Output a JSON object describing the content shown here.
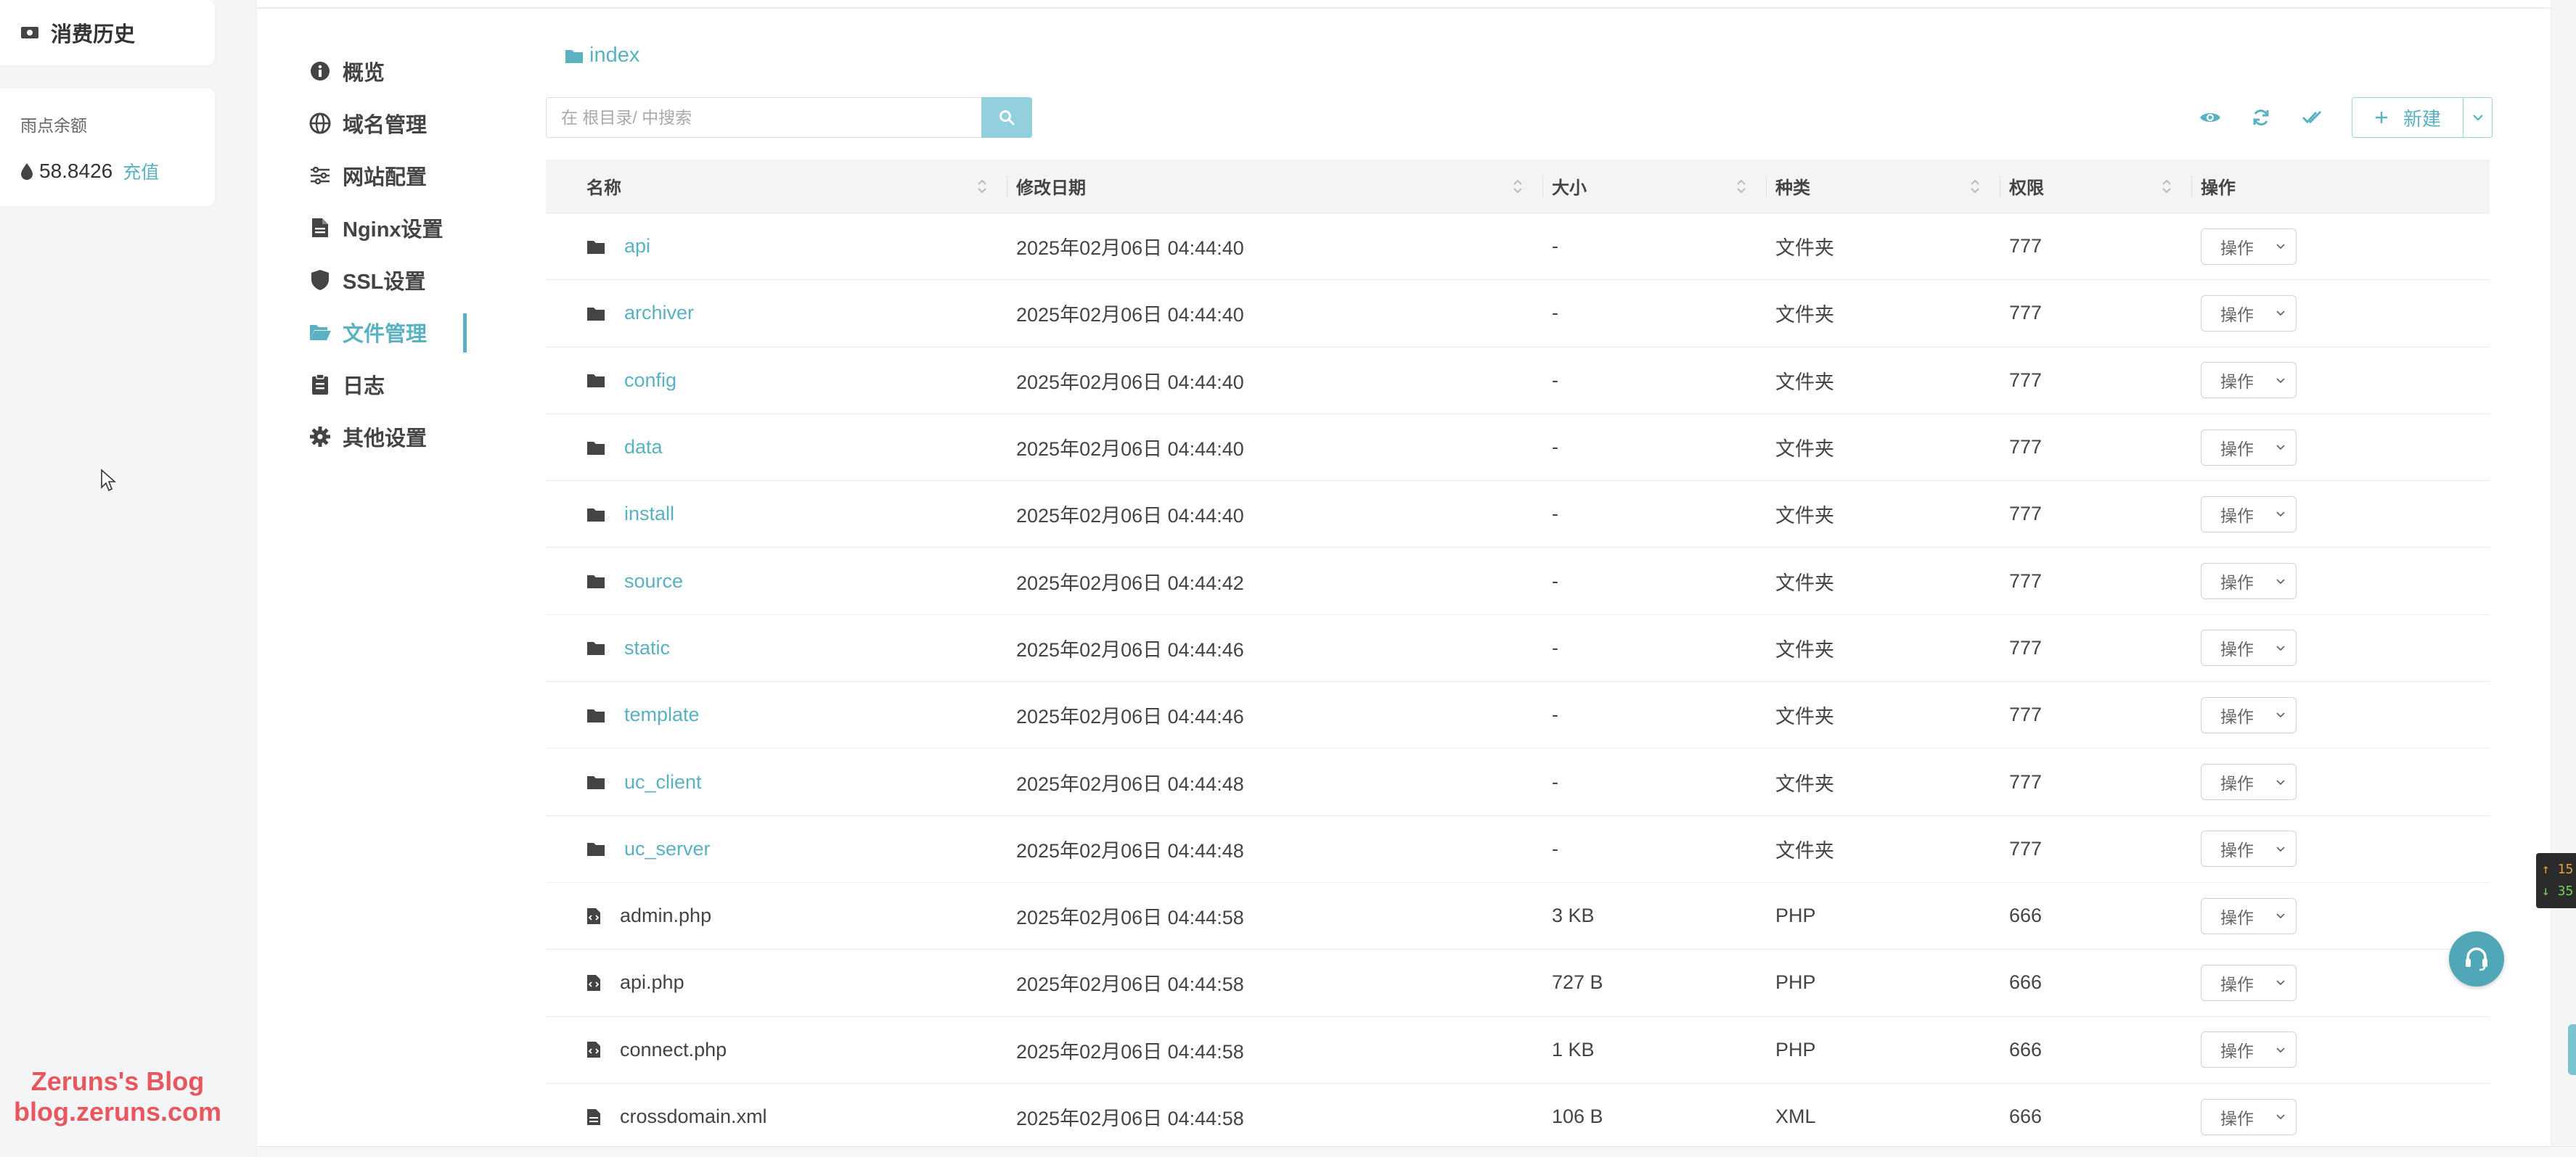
{
  "account": {
    "history_label": "消费历史",
    "balance_label": "雨点余额",
    "balance_value": "58.8426",
    "recharge_label": "充值"
  },
  "watermark": {
    "line1": "Zeruns's Blog",
    "line2": "blog.zeruns.com"
  },
  "sub_nav": {
    "items": [
      {
        "label": "概览",
        "icon": "info-icon"
      },
      {
        "label": "域名管理",
        "icon": "globe-icon"
      },
      {
        "label": "网站配置",
        "icon": "sliders-icon"
      },
      {
        "label": "Nginx设置",
        "icon": "file-icon"
      },
      {
        "label": "SSL设置",
        "icon": "shield-icon"
      },
      {
        "label": "文件管理",
        "icon": "folder-open-icon",
        "active": true
      },
      {
        "label": "日志",
        "icon": "clipboard-icon"
      },
      {
        "label": "其他设置",
        "icon": "gear-icon"
      }
    ]
  },
  "file_manager": {
    "breadcrumb": "index",
    "search_placeholder": "在 根目录/ 中搜索",
    "new_button_label": "新建",
    "columns": {
      "name": "名称",
      "date": "修改日期",
      "size": "大小",
      "kind": "种类",
      "perm": "权限",
      "op": "操作"
    },
    "op_label": "操作",
    "rows": [
      {
        "name": "api",
        "type": "folder",
        "date": "2025年02月06日 04:44:40",
        "size": "-",
        "kind": "文件夹",
        "perm": "777"
      },
      {
        "name": "archiver",
        "type": "folder",
        "date": "2025年02月06日 04:44:40",
        "size": "-",
        "kind": "文件夹",
        "perm": "777"
      },
      {
        "name": "config",
        "type": "folder",
        "date": "2025年02月06日 04:44:40",
        "size": "-",
        "kind": "文件夹",
        "perm": "777"
      },
      {
        "name": "data",
        "type": "folder",
        "date": "2025年02月06日 04:44:40",
        "size": "-",
        "kind": "文件夹",
        "perm": "777"
      },
      {
        "name": "install",
        "type": "folder",
        "date": "2025年02月06日 04:44:40",
        "size": "-",
        "kind": "文件夹",
        "perm": "777"
      },
      {
        "name": "source",
        "type": "folder",
        "date": "2025年02月06日 04:44:42",
        "size": "-",
        "kind": "文件夹",
        "perm": "777"
      },
      {
        "name": "static",
        "type": "folder",
        "date": "2025年02月06日 04:44:46",
        "size": "-",
        "kind": "文件夹",
        "perm": "777"
      },
      {
        "name": "template",
        "type": "folder",
        "date": "2025年02月06日 04:44:46",
        "size": "-",
        "kind": "文件夹",
        "perm": "777"
      },
      {
        "name": "uc_client",
        "type": "folder",
        "date": "2025年02月06日 04:44:48",
        "size": "-",
        "kind": "文件夹",
        "perm": "777"
      },
      {
        "name": "uc_server",
        "type": "folder",
        "date": "2025年02月06日 04:44:48",
        "size": "-",
        "kind": "文件夹",
        "perm": "777"
      },
      {
        "name": "admin.php",
        "type": "code",
        "date": "2025年02月06日 04:44:58",
        "size": "3 KB",
        "kind": "PHP",
        "perm": "666"
      },
      {
        "name": "api.php",
        "type": "code",
        "date": "2025年02月06日 04:44:58",
        "size": "727 B",
        "kind": "PHP",
        "perm": "666"
      },
      {
        "name": "connect.php",
        "type": "code",
        "date": "2025年02月06日 04:44:58",
        "size": "1 KB",
        "kind": "PHP",
        "perm": "666"
      },
      {
        "name": "crossdomain.xml",
        "type": "file",
        "date": "2025年02月06日 04:44:58",
        "size": "106 B",
        "kind": "XML",
        "perm": "666"
      }
    ]
  },
  "speed": {
    "up": "↑ 15",
    "down": "↓ 35"
  },
  "colors": {
    "accent": "#5ab1c2",
    "search_button": "#91d0dc"
  }
}
